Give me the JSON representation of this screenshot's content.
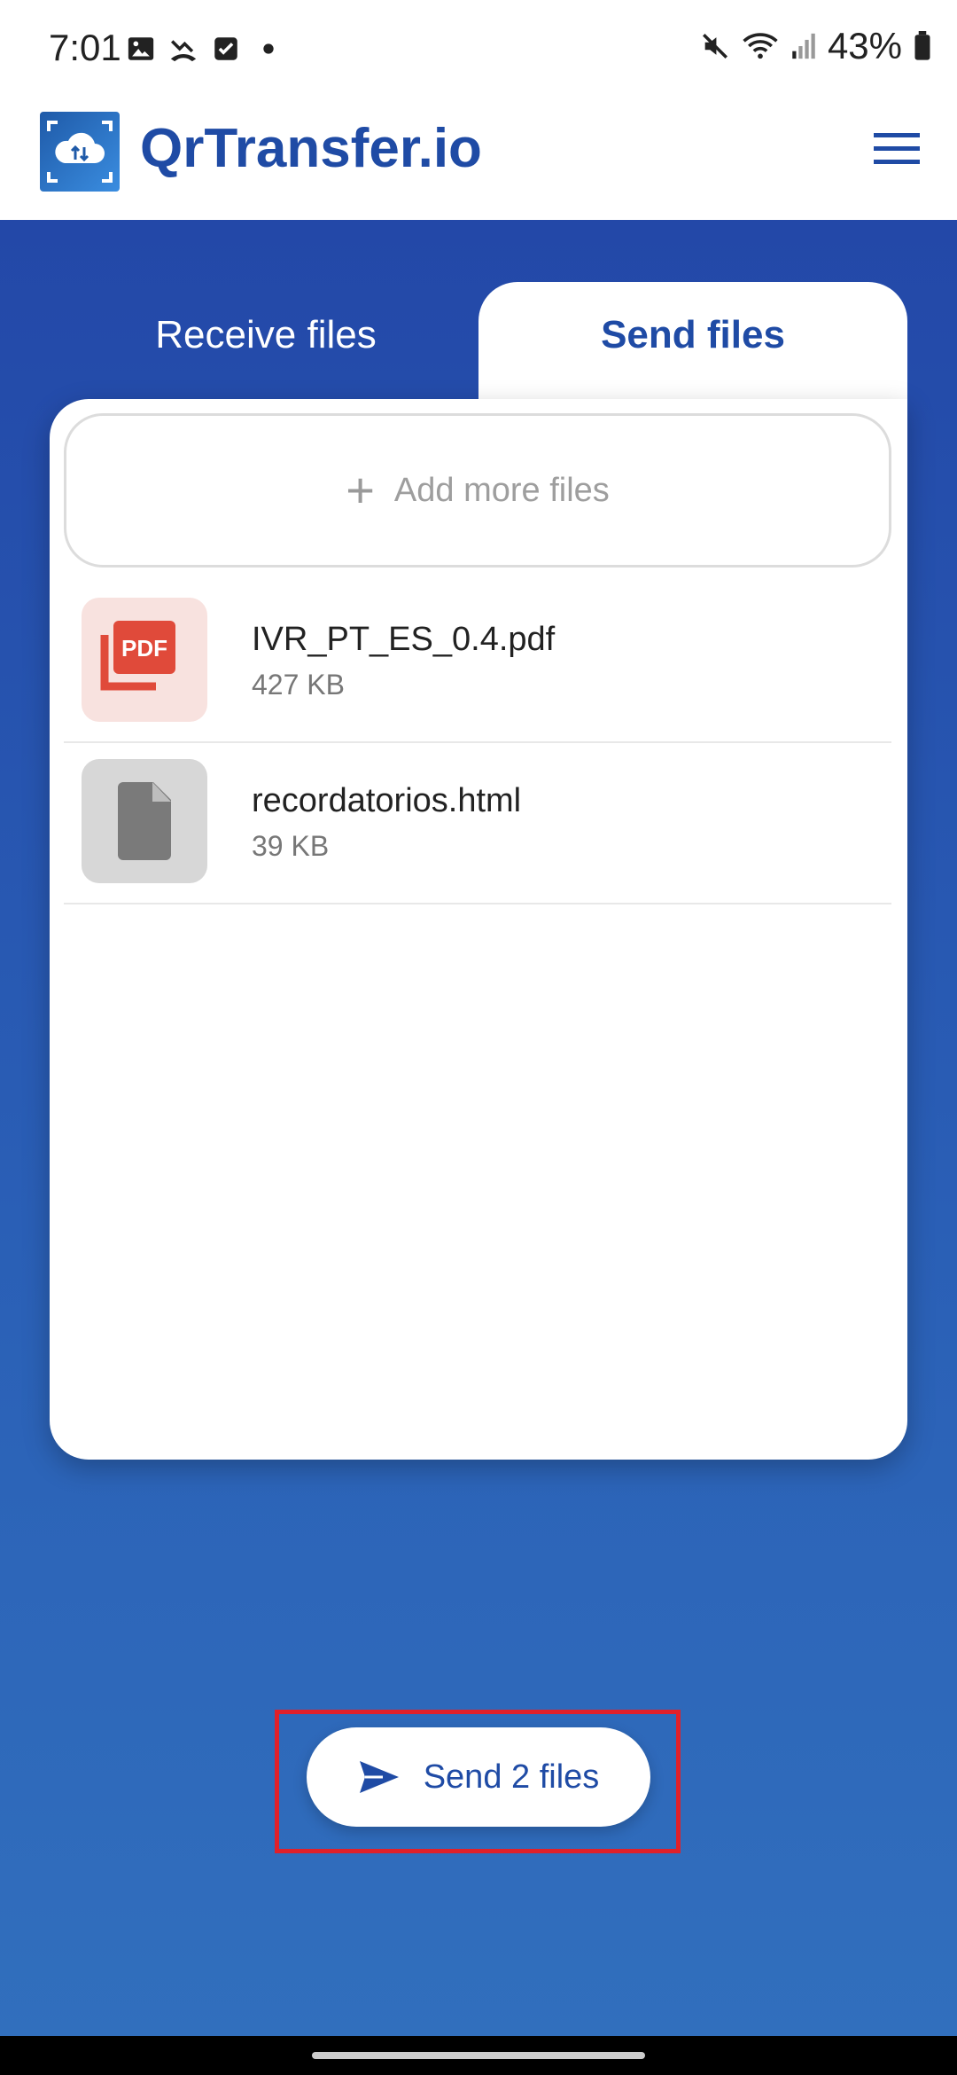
{
  "status_bar": {
    "time": "7:01",
    "battery": "43%",
    "icons": [
      "image-icon",
      "missed-call-icon",
      "checkbox-icon",
      "dot-icon",
      "mute-icon",
      "wifi-icon",
      "signal-icon",
      "battery-icon"
    ]
  },
  "app_bar": {
    "title": "QrTransfer.io",
    "menu_icon": "hamburger-menu-icon"
  },
  "tabs": {
    "receive_label": "Receive files",
    "send_label": "Send files",
    "active": "send"
  },
  "files_panel": {
    "add_more_label": "Add more files",
    "files": [
      {
        "name": "IVR_PT_ES_0.4.pdf",
        "size": "427 KB",
        "icon": "pdf-icon"
      },
      {
        "name": "recordatorios.html",
        "size": "39 KB",
        "icon": "generic-file-icon"
      }
    ]
  },
  "send_button": {
    "label": "Send 2 files",
    "icon": "send-icon"
  },
  "colors": {
    "primary": "#1f4ba5",
    "background_gradient_top": "#2348a8",
    "background_gradient_bottom": "#316fbd",
    "highlight": "#e0202a",
    "pdf_red": "#e04a3a"
  }
}
